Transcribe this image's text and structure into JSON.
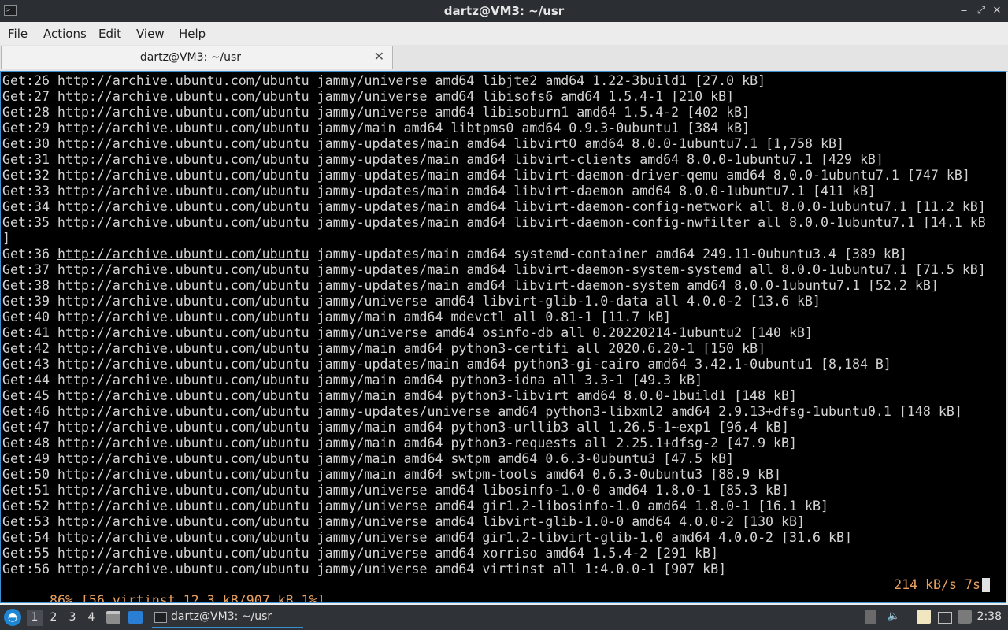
{
  "window": {
    "title": "dartz@VM3: ~/usr",
    "controls": {
      "minimize": "‒",
      "maximize": "⤢",
      "close": "✕"
    }
  },
  "menu": [
    "File",
    "Actions",
    "Edit",
    "View",
    "Help"
  ],
  "tab": {
    "label": "dartz@VM3: ~/usr",
    "close": "✕"
  },
  "terminal": {
    "lines": [
      "Get:26 http://archive.ubuntu.com/ubuntu jammy/universe amd64 libjte2 amd64 1.22-3build1 [27.0 kB]",
      "Get:27 http://archive.ubuntu.com/ubuntu jammy/universe amd64 libisofs6 amd64 1.5.4-1 [210 kB]",
      "Get:28 http://archive.ubuntu.com/ubuntu jammy/universe amd64 libisoburn1 amd64 1.5.4-2 [402 kB]",
      "Get:29 http://archive.ubuntu.com/ubuntu jammy/main amd64 libtpms0 amd64 0.9.3-0ubuntu1 [384 kB]",
      "Get:30 http://archive.ubuntu.com/ubuntu jammy-updates/main amd64 libvirt0 amd64 8.0.0-1ubuntu7.1 [1,758 kB]",
      "Get:31 http://archive.ubuntu.com/ubuntu jammy-updates/main amd64 libvirt-clients amd64 8.0.0-1ubuntu7.1 [429 kB]",
      "Get:32 http://archive.ubuntu.com/ubuntu jammy-updates/main amd64 libvirt-daemon-driver-qemu amd64 8.0.0-1ubuntu7.1 [747 kB]",
      "Get:33 http://archive.ubuntu.com/ubuntu jammy-updates/main amd64 libvirt-daemon amd64 8.0.0-1ubuntu7.1 [411 kB]",
      "Get:34 http://archive.ubuntu.com/ubuntu jammy-updates/main amd64 libvirt-daemon-config-network all 8.0.0-1ubuntu7.1 [11.2 kB]",
      "Get:35 http://archive.ubuntu.com/ubuntu jammy-updates/main amd64 libvirt-daemon-config-nwfilter all 8.0.0-1ubuntu7.1 [14.1 kB",
      "]",
      "Get:37 http://archive.ubuntu.com/ubuntu jammy-updates/main amd64 libvirt-daemon-system-systemd all 8.0.0-1ubuntu7.1 [71.5 kB]",
      "Get:38 http://archive.ubuntu.com/ubuntu jammy-updates/main amd64 libvirt-daemon-system amd64 8.0.0-1ubuntu7.1 [52.2 kB]",
      "Get:39 http://archive.ubuntu.com/ubuntu jammy/universe amd64 libvirt-glib-1.0-data all 4.0.0-2 [13.6 kB]",
      "Get:40 http://archive.ubuntu.com/ubuntu jammy/main amd64 mdevctl all 0.81-1 [11.7 kB]",
      "Get:41 http://archive.ubuntu.com/ubuntu jammy/universe amd64 osinfo-db all 0.20220214-1ubuntu2 [140 kB]",
      "Get:42 http://archive.ubuntu.com/ubuntu jammy/main amd64 python3-certifi all 2020.6.20-1 [150 kB]",
      "Get:43 http://archive.ubuntu.com/ubuntu jammy-updates/main amd64 python3-gi-cairo amd64 3.42.1-0ubuntu1 [8,184 B]",
      "Get:44 http://archive.ubuntu.com/ubuntu jammy/main amd64 python3-idna all 3.3-1 [49.3 kB]",
      "Get:45 http://archive.ubuntu.com/ubuntu jammy/main amd64 python3-libvirt amd64 8.0.0-1build1 [148 kB]",
      "Get:46 http://archive.ubuntu.com/ubuntu jammy-updates/universe amd64 python3-libxml2 amd64 2.9.13+dfsg-1ubuntu0.1 [148 kB]",
      "Get:47 http://archive.ubuntu.com/ubuntu jammy/main amd64 python3-urllib3 all 1.26.5-1~exp1 [96.4 kB]",
      "Get:48 http://archive.ubuntu.com/ubuntu jammy/main amd64 python3-requests all 2.25.1+dfsg-2 [47.9 kB]",
      "Get:49 http://archive.ubuntu.com/ubuntu jammy/main amd64 swtpm amd64 0.6.3-0ubuntu3 [47.5 kB]",
      "Get:50 http://archive.ubuntu.com/ubuntu jammy/main amd64 swtpm-tools amd64 0.6.3-0ubuntu3 [88.9 kB]",
      "Get:51 http://archive.ubuntu.com/ubuntu jammy/universe amd64 libosinfo-1.0-0 amd64 1.8.0-1 [85.3 kB]",
      "Get:52 http://archive.ubuntu.com/ubuntu jammy/universe amd64 gir1.2-libosinfo-1.0 amd64 1.8.0-1 [16.1 kB]",
      "Get:53 http://archive.ubuntu.com/ubuntu jammy/universe amd64 libvirt-glib-1.0-0 amd64 4.0.0-2 [130 kB]",
      "Get:54 http://archive.ubuntu.com/ubuntu jammy/universe amd64 gir1.2-libvirt-glib-1.0 amd64 4.0.0-2 [31.6 kB]",
      "Get:55 http://archive.ubuntu.com/ubuntu jammy/universe amd64 xorriso amd64 1.5.4-2 [291 kB]",
      "Get:56 http://archive.ubuntu.com/ubuntu jammy/universe amd64 virtinst all 1:4.0.0-1 [907 kB]"
    ],
    "link_line": {
      "prefix": "Get:36 ",
      "url": "http://archive.ubuntu.com/ubuntu",
      "suffix": " jammy-updates/main amd64 systemd-container amd64 249.11-0ubuntu3.4 [389 kB]"
    },
    "progress": {
      "left": "86% [56 virtinst 12.3 kB/907 kB 1%]",
      "right": "214 kB/s 7s"
    }
  },
  "taskbar": {
    "workspaces": [
      "1",
      "2",
      "3",
      "4"
    ],
    "active_workspace": "1",
    "task_label": "dartz@VM3: ~/usr",
    "clock": "2:38"
  },
  "colors": {
    "terminal_bg": "#000000",
    "terminal_fg": "#d3d3d3",
    "progress_fg": "#e8a060",
    "accent": "#3a8fd0",
    "titlebar_bg": "#2b2f33",
    "taskbar_bg": "#2f3236"
  },
  "icons": [
    "terminal-icon",
    "minimize-icon",
    "maximize-icon",
    "close-icon",
    "start-menu-icon",
    "files-icon",
    "desktop-icon",
    "tray-clipboard-icon",
    "tray-volume-icon",
    "tray-notes-icon",
    "tray-display-icon",
    "tray-network-icon"
  ]
}
